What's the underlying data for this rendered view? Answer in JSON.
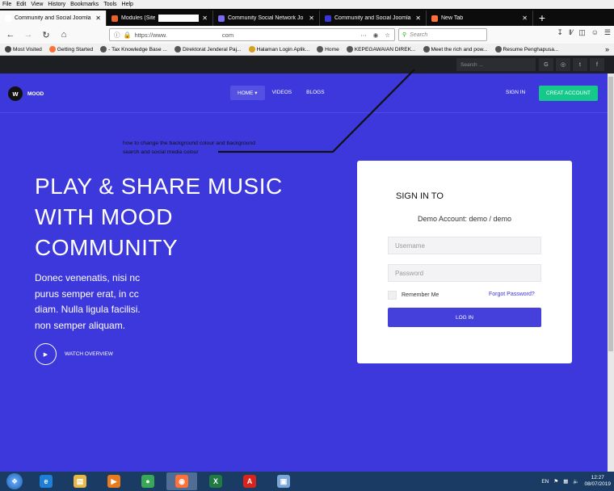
{
  "menubar": {
    "items": [
      "File",
      "Edit",
      "View",
      "History",
      "Bookmarks",
      "Tools",
      "Help"
    ]
  },
  "tabs": [
    {
      "title": "Community and Social Joomla",
      "active": true,
      "favcolor": "#ffffff"
    },
    {
      "title": "Modules (Site) -",
      "active": false,
      "favcolor": "#e8622c"
    },
    {
      "title": "Community Social Network Jo",
      "active": false,
      "favcolor": "#7a6cf0"
    },
    {
      "title": "Community and Social Joomla tem",
      "active": false,
      "favcolor": "#3b36d8"
    },
    {
      "title": "New Tab",
      "active": false,
      "favcolor": "#ff7139"
    }
  ],
  "newtab_label": "+",
  "urlbar": {
    "prefix": "https://www.",
    "domain": "com"
  },
  "searchbar": {
    "placeholder": "Search"
  },
  "bookmarks": [
    {
      "label": "Most Visited",
      "color": "#444"
    },
    {
      "label": "Getting Started",
      "color": "#ff7139"
    },
    {
      "label": "- Tax Knowledge Base ...",
      "color": "#555"
    },
    {
      "label": "Direktorat Jenderal Paj...",
      "color": "#555"
    },
    {
      "label": "Halaman Login  Aplik...",
      "color": "#d4a020"
    },
    {
      "label": "Home",
      "color": "#555"
    },
    {
      "label": "KEPEGAWAIAN DIREK...",
      "color": "#555"
    },
    {
      "label": "Meet the rich and pow...",
      "color": "#555"
    },
    {
      "label": "Resume  Penghapusa...",
      "color": "#555"
    }
  ],
  "topbar": {
    "search_placeholder": "Search ...",
    "socials": [
      "G",
      "◎",
      "t",
      "f"
    ]
  },
  "site": {
    "logo_text": "MOOD",
    "logo_mark": "w",
    "nav": [
      {
        "label": "HOME ▾",
        "active": true
      },
      {
        "label": "VIDEOS",
        "active": false
      },
      {
        "label": "BLOGS",
        "active": false
      }
    ],
    "signin": "SIGN IN",
    "create": "CREAT ACCOUNT"
  },
  "annotation": {
    "line1": "how to change the background colour and background",
    "line2": "search and social media colour"
  },
  "hero": {
    "headline": [
      "PLAY & SHARE MUSIC",
      "WITH MOOD",
      "COMMUNITY"
    ],
    "lead": [
      "Donec venenatis, nisi nc",
      "purus semper erat, in cc",
      "diam. Nulla ligula facilisi.",
      "non semper aliquam."
    ],
    "watch_label": "WATCH OVERVIEW"
  },
  "login": {
    "title": "SIGN IN TO",
    "demo": "Demo Account: demo / demo",
    "username_placeholder": "Username",
    "password_placeholder": "Password",
    "remember": "Remember Me",
    "forgot": "Forgot Password?",
    "button": "LOG IN"
  },
  "taskbar": {
    "apps": [
      {
        "name": "ie",
        "glyph": "e",
        "color": "#1e7fd8",
        "active": false
      },
      {
        "name": "explorer",
        "glyph": "▤",
        "color": "#e6b84a",
        "active": false
      },
      {
        "name": "media",
        "glyph": "▶",
        "color": "#e87b1d",
        "active": false
      },
      {
        "name": "chrome",
        "glyph": "●",
        "color": "#3aa757",
        "active": false
      },
      {
        "name": "firefox",
        "glyph": "◉",
        "color": "#ff7139",
        "active": true
      },
      {
        "name": "excel",
        "glyph": "X",
        "color": "#1f7a43",
        "active": false
      },
      {
        "name": "acrobat",
        "glyph": "A",
        "color": "#d8241c",
        "active": false
      },
      {
        "name": "other",
        "glyph": "▣",
        "color": "#7ba7d8",
        "active": false
      }
    ],
    "lang": "EN",
    "time": "12:27",
    "date": "08/07/2019"
  },
  "colors": {
    "hero_bg": "#3d38db",
    "accent_green": "#15c98b",
    "dark_bar": "#1e1f22"
  }
}
